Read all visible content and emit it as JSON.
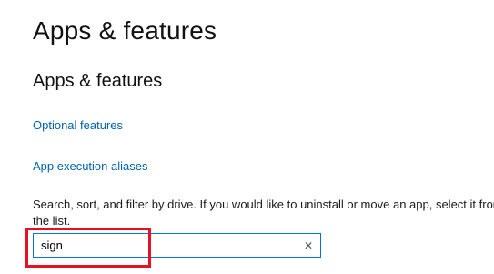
{
  "page": {
    "title": "Apps & features"
  },
  "section": {
    "title": "Apps & features",
    "links": {
      "optional_features": "Optional features",
      "app_execution_aliases": "App execution aliases"
    },
    "description": "Search, sort, and filter by drive. If you would like to uninstall or move an app, select it from the list."
  },
  "search": {
    "value": "sign",
    "clear_glyph": "✕"
  },
  "colors": {
    "link": "#0063b1",
    "focus_border": "#0078d7",
    "highlight": "#e81123"
  }
}
